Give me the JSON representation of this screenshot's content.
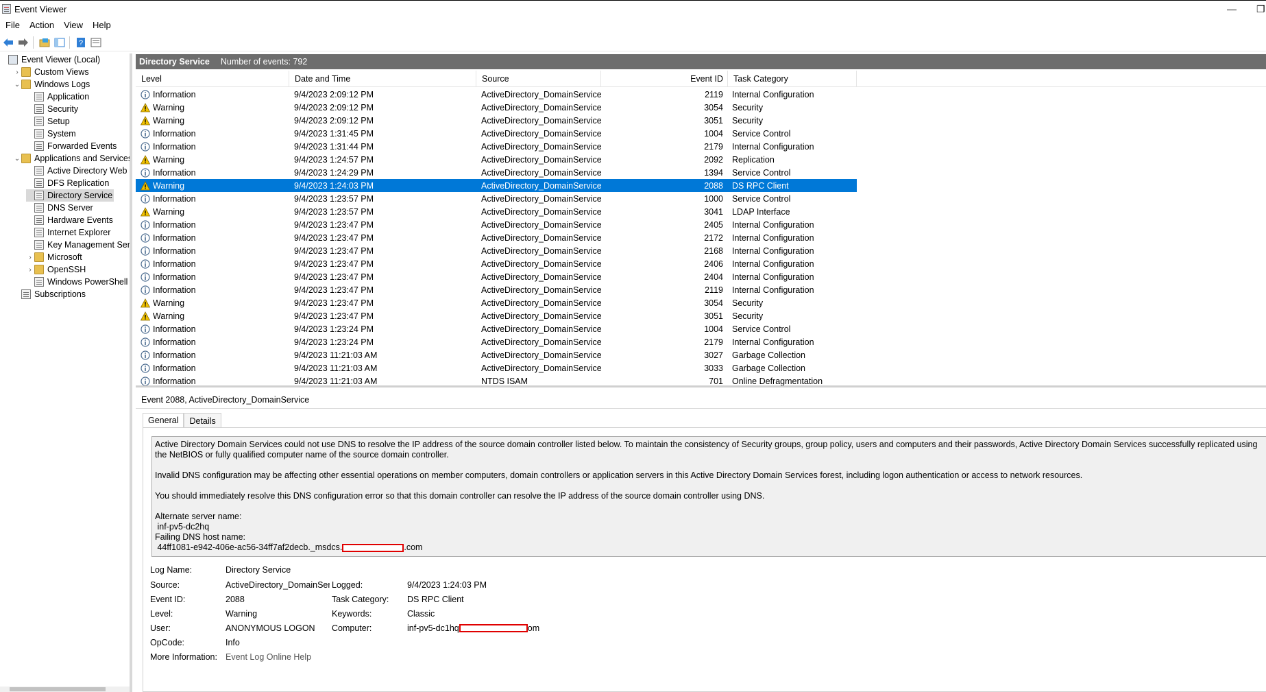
{
  "window": {
    "title": "Event Viewer",
    "minimize": "—",
    "restore": "❐"
  },
  "menu": [
    "File",
    "Action",
    "View",
    "Help"
  ],
  "toolbar_icons": [
    "back-icon",
    "forward-icon",
    "open-folder-icon",
    "console-tree-icon",
    "help-icon",
    "properties-icon"
  ],
  "tree": [
    {
      "label": "Event Viewer (Local)",
      "x": 0,
      "expander": "",
      "icon": "ev"
    },
    {
      "label": "Custom Views",
      "x": 1,
      "expander": "›",
      "icon": "folder"
    },
    {
      "label": "Windows Logs",
      "x": 1,
      "expander": "⌄",
      "icon": "folder"
    },
    {
      "label": "Application",
      "x": 2,
      "expander": "",
      "icon": "log"
    },
    {
      "label": "Security",
      "x": 2,
      "expander": "",
      "icon": "log"
    },
    {
      "label": "Setup",
      "x": 2,
      "expander": "",
      "icon": "log"
    },
    {
      "label": "System",
      "x": 2,
      "expander": "",
      "icon": "log"
    },
    {
      "label": "Forwarded Events",
      "x": 2,
      "expander": "",
      "icon": "log"
    },
    {
      "label": "Applications and Services Lo",
      "x": 1,
      "expander": "⌄",
      "icon": "folder"
    },
    {
      "label": "Active Directory Web Ser",
      "x": 2,
      "expander": "",
      "icon": "log"
    },
    {
      "label": "DFS Replication",
      "x": 2,
      "expander": "",
      "icon": "log"
    },
    {
      "label": "Directory Service",
      "x": 2,
      "expander": "",
      "icon": "log",
      "selected": true
    },
    {
      "label": "DNS Server",
      "x": 2,
      "expander": "",
      "icon": "log"
    },
    {
      "label": "Hardware Events",
      "x": 2,
      "expander": "",
      "icon": "log"
    },
    {
      "label": "Internet Explorer",
      "x": 2,
      "expander": "",
      "icon": "log"
    },
    {
      "label": "Key Management Service",
      "x": 2,
      "expander": "",
      "icon": "log"
    },
    {
      "label": "Microsoft",
      "x": 2,
      "expander": "›",
      "icon": "folder"
    },
    {
      "label": "OpenSSH",
      "x": 2,
      "expander": "›",
      "icon": "folder"
    },
    {
      "label": "Windows PowerShell",
      "x": 2,
      "expander": "",
      "icon": "log"
    },
    {
      "label": "Subscriptions",
      "x": 1,
      "expander": "",
      "icon": "log"
    }
  ],
  "pane": {
    "title": "Directory Service",
    "count": "Number of events: 792"
  },
  "columns": [
    "Level",
    "Date and Time",
    "Source",
    "Event ID",
    "Task Category"
  ],
  "rows": [
    [
      "Information",
      "9/4/2023 2:09:12 PM",
      "ActiveDirectory_DomainService",
      "2119",
      "Internal Configuration"
    ],
    [
      "Warning",
      "9/4/2023 2:09:12 PM",
      "ActiveDirectory_DomainService",
      "3054",
      "Security"
    ],
    [
      "Warning",
      "9/4/2023 2:09:12 PM",
      "ActiveDirectory_DomainService",
      "3051",
      "Security"
    ],
    [
      "Information",
      "9/4/2023 1:31:45 PM",
      "ActiveDirectory_DomainService",
      "1004",
      "Service Control"
    ],
    [
      "Information",
      "9/4/2023 1:31:44 PM",
      "ActiveDirectory_DomainService",
      "2179",
      "Internal Configuration"
    ],
    [
      "Warning",
      "9/4/2023 1:24:57 PM",
      "ActiveDirectory_DomainService",
      "2092",
      "Replication"
    ],
    [
      "Information",
      "9/4/2023 1:24:29 PM",
      "ActiveDirectory_DomainService",
      "1394",
      "Service Control"
    ],
    [
      "Warning",
      "9/4/2023 1:24:03 PM",
      "ActiveDirectory_DomainService",
      "2088",
      "DS RPC Client"
    ],
    [
      "Information",
      "9/4/2023 1:23:57 PM",
      "ActiveDirectory_DomainService",
      "1000",
      "Service Control"
    ],
    [
      "Warning",
      "9/4/2023 1:23:57 PM",
      "ActiveDirectory_DomainService",
      "3041",
      "LDAP Interface"
    ],
    [
      "Information",
      "9/4/2023 1:23:47 PM",
      "ActiveDirectory_DomainService",
      "2405",
      "Internal Configuration"
    ],
    [
      "Information",
      "9/4/2023 1:23:47 PM",
      "ActiveDirectory_DomainService",
      "2172",
      "Internal Configuration"
    ],
    [
      "Information",
      "9/4/2023 1:23:47 PM",
      "ActiveDirectory_DomainService",
      "2168",
      "Internal Configuration"
    ],
    [
      "Information",
      "9/4/2023 1:23:47 PM",
      "ActiveDirectory_DomainService",
      "2406",
      "Internal Configuration"
    ],
    [
      "Information",
      "9/4/2023 1:23:47 PM",
      "ActiveDirectory_DomainService",
      "2404",
      "Internal Configuration"
    ],
    [
      "Information",
      "9/4/2023 1:23:47 PM",
      "ActiveDirectory_DomainService",
      "2119",
      "Internal Configuration"
    ],
    [
      "Warning",
      "9/4/2023 1:23:47 PM",
      "ActiveDirectory_DomainService",
      "3054",
      "Security"
    ],
    [
      "Warning",
      "9/4/2023 1:23:47 PM",
      "ActiveDirectory_DomainService",
      "3051",
      "Security"
    ],
    [
      "Information",
      "9/4/2023 1:23:24 PM",
      "ActiveDirectory_DomainService",
      "1004",
      "Service Control"
    ],
    [
      "Information",
      "9/4/2023 1:23:24 PM",
      "ActiveDirectory_DomainService",
      "2179",
      "Internal Configuration"
    ],
    [
      "Information",
      "9/4/2023 11:21:03 AM",
      "ActiveDirectory_DomainService",
      "3027",
      "Garbage Collection"
    ],
    [
      "Information",
      "9/4/2023 11:21:03 AM",
      "ActiveDirectory_DomainService",
      "3033",
      "Garbage Collection"
    ],
    [
      "Information",
      "9/4/2023 11:21:03 AM",
      "NTDS ISAM",
      "701",
      "Online Defragmentation"
    ]
  ],
  "selected_row": 7,
  "detail": {
    "title": "Event 2088, ActiveDirectory_DomainService",
    "tabs": [
      "General",
      "Details"
    ],
    "message": {
      "p1": "Active Directory Domain Services could not use DNS to resolve the IP address of the source domain controller listed below. To maintain the consistency of Security groups, group policy, users and computers and their passwords, Active Directory Domain Services successfully replicated using the NetBIOS or fully qualified computer name of the source domain controller.",
      "p2": "Invalid DNS configuration may be affecting other essential operations on member computers, domain controllers or application servers in this Active Directory Domain Services forest, including logon authentication or access to network resources.",
      "p3": "You should immediately resolve this DNS configuration error so that this domain controller can resolve the IP address of the source domain controller using DNS.",
      "alt_label": "Alternate server name:",
      "alt_value": " inf-pv5-dc2hq",
      "fail_label": "Failing DNS host name:",
      "fail_value": " 44ff1081-e942-406e-ac56-34ff7af2decb._msdcs.",
      "fail_suffix": ".com"
    },
    "props": {
      "log_name_label": "Log Name:",
      "log_name": "Directory Service",
      "source_label": "Source:",
      "source": "ActiveDirectory_DomainServ",
      "logged_label": "Logged:",
      "logged": "9/4/2023 1:24:03 PM",
      "event_id_label": "Event ID:",
      "event_id": "2088",
      "task_label": "Task Category:",
      "task": "DS RPC Client",
      "level_label": "Level:",
      "level": "Warning",
      "keywords_label": "Keywords:",
      "keywords": "Classic",
      "user_label": "User:",
      "user": "ANONYMOUS LOGON",
      "computer_label": "Computer:",
      "computer": "inf-pv5-dc1hq",
      "computer_suffix": "om",
      "opcode_label": "OpCode:",
      "opcode": "Info",
      "more_label": "More Information:",
      "more_link": "Event Log Online Help"
    }
  }
}
